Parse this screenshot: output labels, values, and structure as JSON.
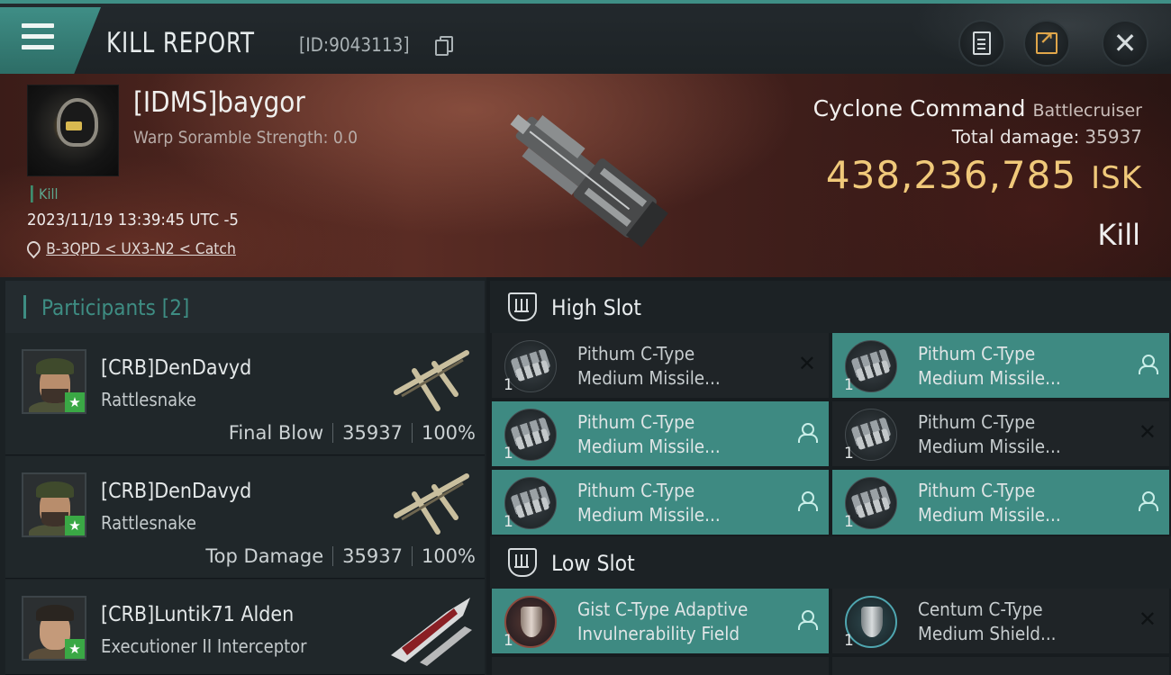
{
  "header": {
    "title": "KILL REPORT",
    "report_id": "[ID:9043113]",
    "buttons": [
      "copy-icon",
      "clipboard-icon",
      "export-icon",
      "close-icon"
    ]
  },
  "victim": {
    "name": "[IDMS]baygor",
    "warp_scramble": "Warp Soramble Strength: 0.0",
    "kill_tag": "Kill",
    "datetime": "2023/11/19 13:39:45 UTC -5",
    "location": "B-3QPD < UX3-N2 < Catch",
    "ship_name": "Cyclone Command",
    "ship_class": "Battlecruiser",
    "total_damage_label": "Total damage:",
    "total_damage": "35937",
    "isk_value": "438,236,785",
    "isk_unit": "ISK",
    "status": "Kill"
  },
  "participants": {
    "title": "Participants",
    "count": "[2]",
    "items": [
      {
        "name": "[CRB]DenDavyd",
        "ship": "Rattlesnake",
        "role": "Final Blow",
        "damage": "35937",
        "percent": "100%"
      },
      {
        "name": "[CRB]DenDavyd",
        "ship": "Rattlesnake",
        "role": "Top Damage",
        "damage": "35937",
        "percent": "100%"
      },
      {
        "name": "[CRB]Luntik71 Alden",
        "ship": "Executioner II Interceptor"
      }
    ]
  },
  "slots": {
    "high": {
      "title": "High Slot",
      "modules": [
        {
          "line1": "Pithum C-Type",
          "line2": "Medium Missile...",
          "qty": "1",
          "status": "destroyed"
        },
        {
          "line1": "Pithum C-Type",
          "line2": "Medium Missile...",
          "qty": "1",
          "status": "dropped"
        },
        {
          "line1": "Pithum C-Type",
          "line2": "Medium Missile...",
          "qty": "1",
          "status": "dropped"
        },
        {
          "line1": "Pithum C-Type",
          "line2": "Medium Missile...",
          "qty": "1",
          "status": "destroyed"
        },
        {
          "line1": "Pithum C-Type",
          "line2": "Medium Missile...",
          "qty": "1",
          "status": "dropped"
        },
        {
          "line1": "Pithum C-Type",
          "line2": "Medium Missile...",
          "qty": "1",
          "status": "dropped"
        }
      ]
    },
    "low": {
      "title": "Low Slot",
      "modules": [
        {
          "line1": "Gist C-Type Adaptive",
          "line2": "Invulnerability Field",
          "qty": "1",
          "status": "dropped"
        },
        {
          "line1": "Centum C-Type",
          "line2": "Medium Shield...",
          "qty": "1",
          "status": "destroyed"
        }
      ]
    }
  },
  "colors": {
    "accent": "#3e8a82",
    "isk": "#f0c97a",
    "star_badge": "#3aa845"
  }
}
